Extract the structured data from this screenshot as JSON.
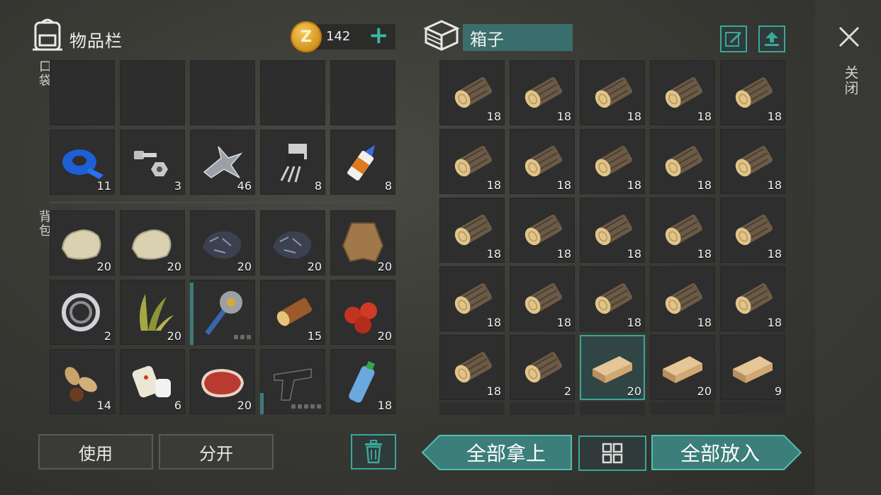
{
  "inventory": {
    "title": "物品栏",
    "coins": "142",
    "coin_letter": "Z",
    "pocket_label": "口袋",
    "backpack_label": "背包",
    "pocket_row1": [
      {
        "icon": "empty",
        "count": ""
      },
      {
        "icon": "empty",
        "count": ""
      },
      {
        "icon": "empty",
        "count": ""
      },
      {
        "icon": "empty",
        "count": ""
      },
      {
        "icon": "empty",
        "count": ""
      }
    ],
    "pocket_row2": [
      {
        "icon": "duct-tape-icon",
        "count": "11"
      },
      {
        "icon": "nuts-bolts-icon",
        "count": "3"
      },
      {
        "icon": "scrap-metal-icon",
        "count": "46"
      },
      {
        "icon": "electronic-component-icon",
        "count": "8"
      },
      {
        "icon": "glue-icon",
        "count": "8"
      }
    ],
    "backpack_row1": [
      {
        "icon": "stone-icon",
        "count": "20"
      },
      {
        "icon": "stone-icon",
        "count": "20"
      },
      {
        "icon": "iron-ore-icon",
        "count": "20"
      },
      {
        "icon": "iron-ore-icon",
        "count": "20"
      },
      {
        "icon": "animal-hide-icon",
        "count": "20"
      }
    ],
    "backpack_row2": [
      {
        "icon": "bearing-icon",
        "count": "2"
      },
      {
        "icon": "plant-fiber-icon",
        "count": "20"
      },
      {
        "icon": "spiked-club-icon",
        "count": ""
      },
      {
        "icon": "wood-log-icon",
        "count": "15"
      },
      {
        "icon": "berries-icon",
        "count": "20"
      }
    ],
    "backpack_row3": [
      {
        "icon": "seeds-icon",
        "count": "14"
      },
      {
        "icon": "bandage-icon",
        "count": "6"
      },
      {
        "icon": "raw-meat-icon",
        "count": "20"
      },
      {
        "icon": "pistol-icon",
        "count": ""
      },
      {
        "icon": "water-bottle-icon",
        "count": "18"
      }
    ],
    "use_label": "使用",
    "split_label": "分开"
  },
  "container": {
    "title": "箱子",
    "close_label": "关闭",
    "take_all_label": "全部拿上",
    "put_all_label": "全部放入",
    "rows": [
      [
        {
          "icon": "log-icon",
          "count": "18"
        },
        {
          "icon": "log-icon",
          "count": "18"
        },
        {
          "icon": "log-icon",
          "count": "18"
        },
        {
          "icon": "log-icon",
          "count": "18"
        },
        {
          "icon": "log-icon",
          "count": "18"
        }
      ],
      [
        {
          "icon": "log-icon",
          "count": "18"
        },
        {
          "icon": "log-icon",
          "count": "18"
        },
        {
          "icon": "log-icon",
          "count": "18"
        },
        {
          "icon": "log-icon",
          "count": "18"
        },
        {
          "icon": "log-icon",
          "count": "18"
        }
      ],
      [
        {
          "icon": "log-icon",
          "count": "18"
        },
        {
          "icon": "log-icon",
          "count": "18"
        },
        {
          "icon": "log-icon",
          "count": "18"
        },
        {
          "icon": "log-icon",
          "count": "18"
        },
        {
          "icon": "log-icon",
          "count": "18"
        }
      ],
      [
        {
          "icon": "log-icon",
          "count": "18"
        },
        {
          "icon": "log-icon",
          "count": "18"
        },
        {
          "icon": "log-icon",
          "count": "18"
        },
        {
          "icon": "log-icon",
          "count": "18"
        },
        {
          "icon": "log-icon",
          "count": "18"
        }
      ],
      [
        {
          "icon": "log-icon",
          "count": "18"
        },
        {
          "icon": "log-icon",
          "count": "2"
        },
        {
          "icon": "plank-icon",
          "count": "20",
          "selected": true
        },
        {
          "icon": "plank-icon",
          "count": "20"
        },
        {
          "icon": "plank-icon",
          "count": "9"
        }
      ]
    ]
  },
  "colors": {
    "accent": "#3aa79a",
    "slot": "#2d2e2d",
    "label_bg": "#3a6e6c"
  }
}
